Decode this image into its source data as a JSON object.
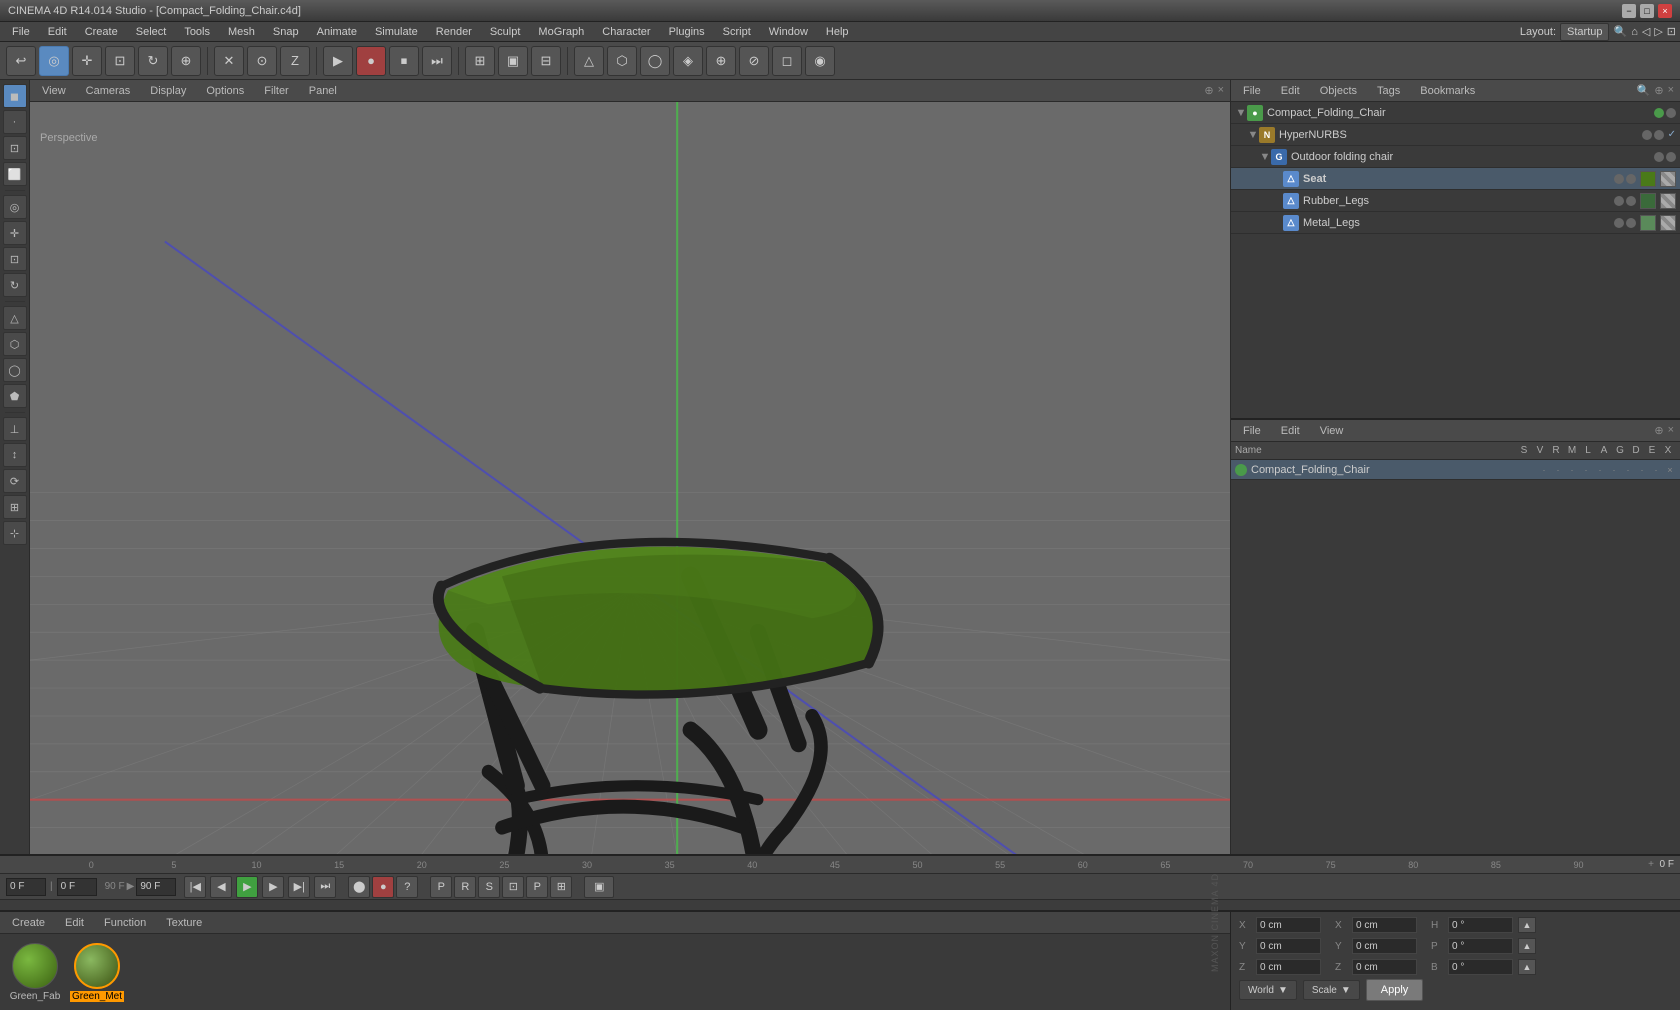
{
  "window": {
    "title": "CINEMA 4D R14.014 Studio - [Compact_Folding_Chair.c4d]",
    "controls": [
      "−",
      "□",
      "×"
    ]
  },
  "menubar": {
    "items": [
      "File",
      "Edit",
      "Create",
      "Select",
      "Tools",
      "Mesh",
      "Snap",
      "Animate",
      "Simulate",
      "Render",
      "Sculpt",
      "MoGraph",
      "Character",
      "Plugins",
      "Script",
      "Window",
      "Help"
    ]
  },
  "toolbar": {
    "layout_label": "Layout:",
    "layout_value": "Startup"
  },
  "viewport": {
    "tabs": [
      "View",
      "Cameras",
      "Display",
      "Options",
      "Filter",
      "Panel"
    ],
    "mode_label": "Perspective"
  },
  "object_manager": {
    "tabs": [
      "File",
      "Edit",
      "Objects",
      "Tags",
      "Bookmarks"
    ],
    "objects": [
      {
        "id": "compact_folding_chair",
        "name": "Compact_Folding_Chair",
        "indent": 0,
        "expand": true,
        "icon": "green-sq",
        "active": true
      },
      {
        "id": "hypernurbs",
        "name": "HyperNURBS",
        "indent": 1,
        "expand": true,
        "icon": "yellow-sq"
      },
      {
        "id": "outdoor_folding_chair",
        "name": "Outdoor folding chair",
        "indent": 2,
        "expand": true,
        "icon": "blue-sq"
      },
      {
        "id": "seat",
        "name": "Seat",
        "indent": 3,
        "expand": false,
        "icon": "triangle"
      },
      {
        "id": "rubber_legs",
        "name": "Rubber_Legs",
        "indent": 3,
        "expand": false,
        "icon": "triangle"
      },
      {
        "id": "metal_legs",
        "name": "Metal_Legs",
        "indent": 3,
        "expand": false,
        "icon": "triangle"
      }
    ]
  },
  "attr_manager": {
    "tabs": [
      "File",
      "Edit",
      "View"
    ],
    "col_headers": [
      "Name",
      "S",
      "V",
      "R",
      "M",
      "L",
      "A",
      "G",
      "D",
      "E",
      "X"
    ],
    "rows": [
      {
        "name": "Compact_Folding_Chair",
        "active": true
      }
    ]
  },
  "timeline": {
    "marks": [
      "0",
      "5",
      "10",
      "15",
      "20",
      "25",
      "30",
      "35",
      "40",
      "45",
      "50",
      "55",
      "60",
      "65",
      "70",
      "75",
      "80",
      "85",
      "90"
    ],
    "current_frame": "0 F",
    "end_frame": "90 F",
    "frame_field": "0 F",
    "max_frame": "90 F"
  },
  "material_bar": {
    "tabs": [
      "Create",
      "Edit",
      "Function",
      "Texture"
    ],
    "materials": [
      {
        "id": "green_fab",
        "name": "Green_Fab",
        "type": "green-fab",
        "selected": false
      },
      {
        "id": "green_met",
        "name": "Green_Met",
        "type": "green-met",
        "selected": true
      }
    ]
  },
  "coords": {
    "x_pos": "0 cm",
    "y_pos": "0 cm",
    "z_pos": "0 cm",
    "x_rot": "0 cm",
    "y_rot": "0 cm",
    "z_rot": "0 cm",
    "h": "0 °",
    "p": "0 °",
    "b": "0 °",
    "space_label": "World",
    "scale_label": "Scale",
    "apply_label": "Apply"
  },
  "left_toolbar": {
    "tools": [
      "↖",
      "⊕",
      "⊞",
      "↺",
      "⊕",
      "✕",
      "⊙",
      "⊘",
      "◻",
      "△",
      "⬡",
      "◯",
      "⬟",
      "⊥",
      "↕",
      "⟳",
      "⊞",
      "⊹",
      "⊕"
    ]
  }
}
